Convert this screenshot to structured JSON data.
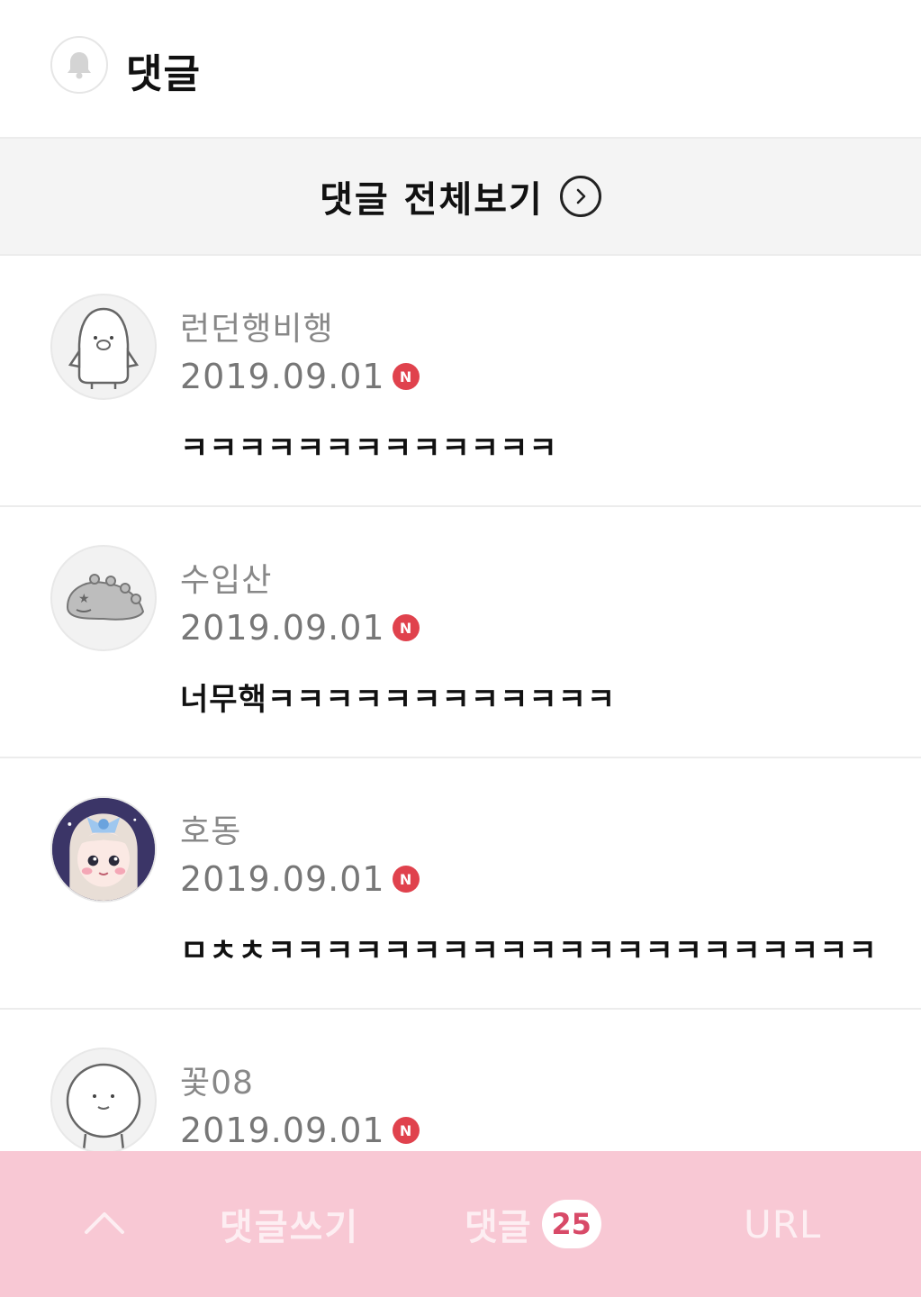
{
  "header": {
    "icon": "bell-icon",
    "title": "댓글"
  },
  "view_all": {
    "label": "댓글 전체보기",
    "icon": "chevron-right-circle-icon"
  },
  "comments": [
    {
      "nickname": "런던행비행",
      "date": "2019.09.01",
      "badge": "N",
      "text": "ㅋㅋㅋㅋㅋㅋㅋㅋㅋㅋㅋㅋㅋ",
      "avatar": "penguin-avatar"
    },
    {
      "nickname": "수입산",
      "date": "2019.09.01",
      "badge": "N",
      "text": "너무핵ㅋㅋㅋㅋㅋㅋㅋㅋㅋㅋㅋㅋ",
      "avatar": "dinosaur-avatar"
    },
    {
      "nickname": "호동",
      "date": "2019.09.01",
      "badge": "N",
      "text": "ㅁㅊㅊㅋㅋㅋㅋㅋㅋㅋㅋㅋㅋㅋㅋㅋㅋㅋㅋㅋㅋㅋㅋㅋ",
      "avatar": "anime-girl-avatar"
    },
    {
      "nickname": "꽃08",
      "date": "2019.09.01",
      "badge": "N",
      "text": "",
      "avatar": "round-face-avatar"
    }
  ],
  "bottom_bar": {
    "up_icon": "chevron-up-icon",
    "write_label": "댓글쓰기",
    "comments_label": "댓글",
    "comment_count": "25",
    "url_label": "URL"
  },
  "colors": {
    "bottom_bar": "#f8c8d4",
    "new_badge": "#e0424d",
    "count_text": "#d84a68"
  }
}
